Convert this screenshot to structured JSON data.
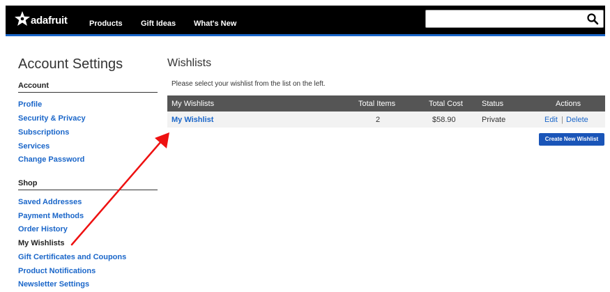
{
  "header": {
    "logo_text": "adafruit",
    "logo_icon": "star-logo-icon",
    "nav": [
      "Products",
      "Gift Ideas",
      "What's New"
    ],
    "search_placeholder": "",
    "search_icon": "search-icon",
    "bar_color": "#000000",
    "accent": "#1a66c9"
  },
  "sidebar": {
    "title": "Account Settings",
    "account_head": "Account",
    "account_items": [
      "Profile",
      "Security & Privacy",
      "Subscriptions",
      "Services",
      "Change Password"
    ],
    "shop_head": "Shop",
    "shop_items": [
      "Saved Addresses",
      "Payment Methods",
      "Order History",
      "My Wishlists",
      "Gift Certificates and Coupons",
      "Product Notifications",
      "Newsletter Settings"
    ],
    "active_item": "My Wishlists"
  },
  "main": {
    "title": "Wishlists",
    "hint": "Please select your wishlist from the list on the left.",
    "columns": [
      "My Wishlists",
      "Total Items",
      "Total Cost",
      "Status",
      "Actions"
    ],
    "rows": [
      {
        "name": "My Wishlist",
        "items": "2",
        "cost": "$58.90",
        "status": "Private",
        "edit": "Edit",
        "sep": "|",
        "delete": "Delete"
      }
    ],
    "create_button": "Create New Wishlist"
  },
  "annotation": {
    "arrow_color": "#ee1111"
  }
}
